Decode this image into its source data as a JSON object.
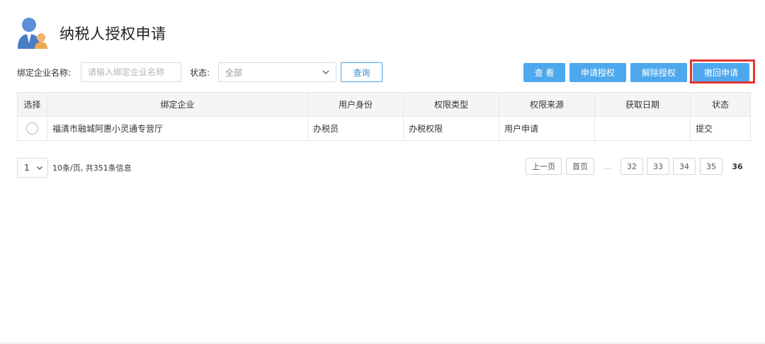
{
  "header": {
    "title": "纳税人授权申请",
    "icon": "user-avatar-icon"
  },
  "filters": {
    "company_label": "绑定企业名称:",
    "company_placeholder": "请输入绑定企业名称",
    "status_label": "状态:",
    "status_value": "全部",
    "query_button": "查询"
  },
  "actions": {
    "view": "查 看",
    "apply_auth": "申请授权",
    "revoke_auth": "解除授权",
    "withdraw_apply": "撤回申请"
  },
  "table": {
    "headers": [
      "选择",
      "绑定企业",
      "用户身份",
      "权限类型",
      "权限来源",
      "获取日期",
      "状态"
    ],
    "rows": [
      {
        "company": "福清市融城阿惠小灵通专营厅",
        "identity": "办税员",
        "permission_type": "办税权限",
        "source": "用户申请",
        "date": "",
        "status": "提交"
      }
    ]
  },
  "pagination": {
    "page_size": "1",
    "info": "10条/页, 共351条信息",
    "prev": "上一页",
    "first": "首页",
    "ellipsis": "...",
    "pages": [
      "32",
      "33",
      "34",
      "35"
    ],
    "current": "36"
  },
  "colors": {
    "primary": "#4ea8ee",
    "highlight": "#e53535",
    "header_bg": "#f4f5f7"
  }
}
